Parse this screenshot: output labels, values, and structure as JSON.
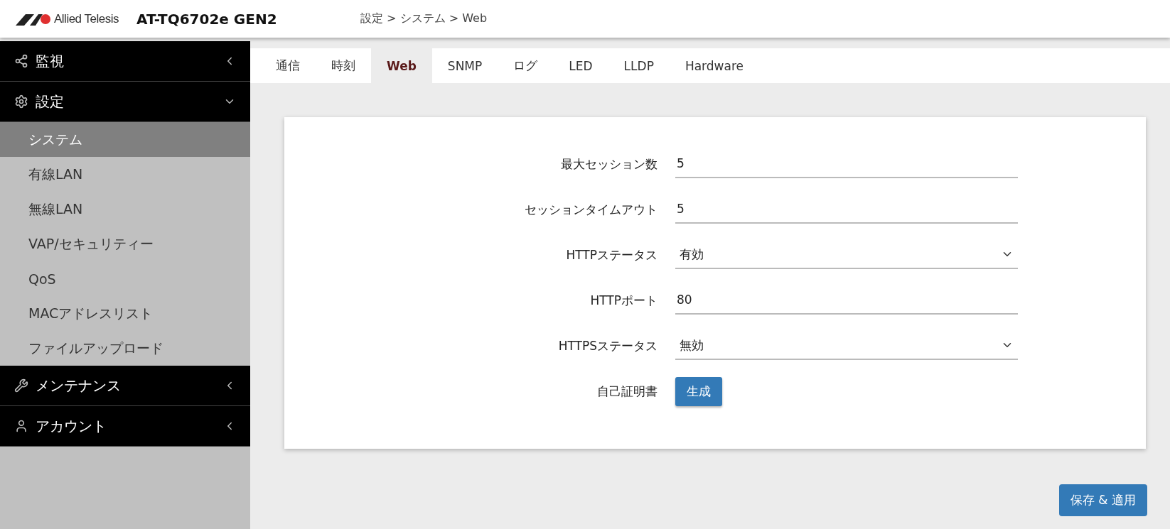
{
  "header": {
    "logo_text": "Allied Telesis",
    "model": "AT-TQ6702e GEN2",
    "breadcrumb": "設定 > システム > Web"
  },
  "sidebar": [
    {
      "kind": "share",
      "label": "監視",
      "expanded": false
    },
    {
      "kind": "gear",
      "label": "設定",
      "expanded": true,
      "children": [
        {
          "label": "システム",
          "selected": true
        },
        {
          "label": "有線LAN",
          "selected": false
        },
        {
          "label": "無線LAN",
          "selected": false
        },
        {
          "label": "VAP/セキュリティー",
          "selected": false
        },
        {
          "label": "QoS",
          "selected": false
        },
        {
          "label": "MACアドレスリスト",
          "selected": false
        },
        {
          "label": "ファイルアップロード",
          "selected": false
        }
      ]
    },
    {
      "kind": "wrench",
      "label": "メンテナンス",
      "expanded": false
    },
    {
      "kind": "user",
      "label": "アカウント",
      "expanded": false
    }
  ],
  "tabs": [
    {
      "label": "通信",
      "selected": false
    },
    {
      "label": "時刻",
      "selected": false
    },
    {
      "label": "Web",
      "selected": true
    },
    {
      "label": "SNMP",
      "selected": false
    },
    {
      "label": "ログ",
      "selected": false
    },
    {
      "label": "LED",
      "selected": false
    },
    {
      "label": "LLDP",
      "selected": false
    },
    {
      "label": "Hardware",
      "selected": false
    }
  ],
  "form": [
    {
      "kind": "text",
      "label": "最大セッション数",
      "value": "5"
    },
    {
      "kind": "text",
      "label": "セッションタイムアウト",
      "value": "5"
    },
    {
      "kind": "select",
      "label": "HTTPステータス",
      "value": "有効"
    },
    {
      "kind": "text",
      "label": "HTTPポート",
      "value": "80"
    },
    {
      "kind": "select",
      "label": "HTTPSステータス",
      "value": "無効"
    },
    {
      "kind": "button",
      "label": "自己証明書",
      "value": "生成"
    }
  ],
  "save_button": "保存 & 適用"
}
